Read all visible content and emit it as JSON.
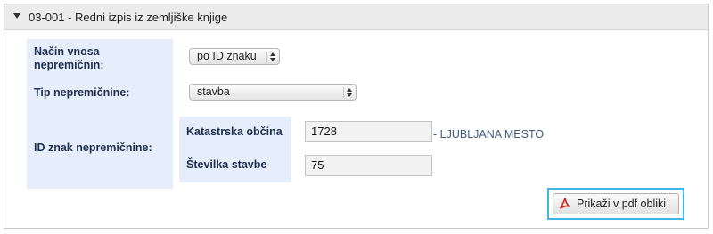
{
  "panel": {
    "title": "03-001 - Redni izpis iz zemljiške knjige"
  },
  "form": {
    "entry_method": {
      "label_line1": "Način vnosa",
      "label_line2": "nepremičnin:",
      "selected": "po ID znaku"
    },
    "property_type": {
      "label": "Tip nepremičnine:",
      "selected": "stavba"
    },
    "property_id": {
      "label": "ID znak nepremičnine:",
      "cadastral_label": "Katastrska občina",
      "cadastral_value": "1728",
      "municipality_name": "- LJUBLJANA MESTO",
      "building_label": "Številka stavbe",
      "building_value": "75"
    }
  },
  "actions": {
    "show_pdf_label": "Prikaži v pdf obliki"
  },
  "colors": {
    "label_bg": "#e6eefb",
    "header_bg": "#ececec",
    "focus_ring": "#41b6e6",
    "link_text": "#3c5a7d"
  }
}
